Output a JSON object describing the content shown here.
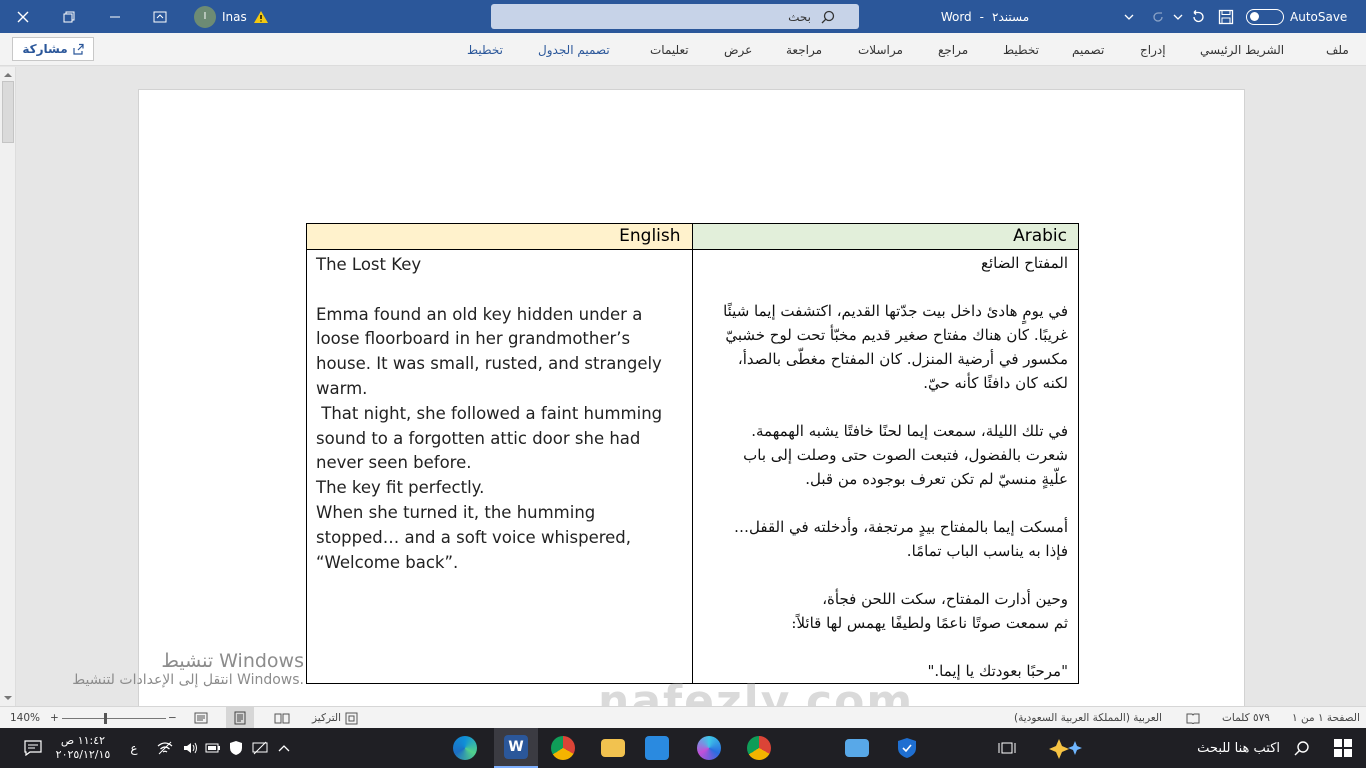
{
  "titlebar": {
    "doc_name": "مستند٢",
    "app_name": "Word",
    "search_placeholder": "بحث",
    "autosave_label": "AutoSave",
    "user_name": "Inas",
    "user_initial": "I"
  },
  "ribbon": {
    "tabs": [
      "ملف",
      "الشريط الرئيسي",
      "إدراج",
      "تصميم",
      "تخطيط",
      "مراجع",
      "مراسلات",
      "مراجعة",
      "عرض",
      "تعليمات"
    ],
    "context_tabs": [
      "تصميم الجدول",
      "تخطيط"
    ],
    "share_label": "مشاركة"
  },
  "table": {
    "header_english": "English",
    "header_arabic": "Arabic",
    "english": {
      "title": "The Lost Key",
      "p1": "Emma found an old key hidden under a loose floorboard in her grandmother’s house. It was small, rusted, and strangely warm.",
      "p2": " That night, she followed a faint humming sound to a forgotten attic door she had never seen before.",
      "p3": "The key fit perfectly.",
      "p4": "When she turned it, the humming stopped… and a soft voice whispered, “Welcome back”."
    },
    "arabic": {
      "title": "المفتاح الضائع",
      "p1": "في يومٍ هادئ داخل بيت جدّتها القديم، اكتشفت إيما شيئًا غريبًا. كان هناك مفتاح صغير قديم مخبّأ تحت لوح خشبيّ مكسور في أرضية المنزل. كان المفتاح مغطّى بالصدأ، لكنه كان دافئًا كأنه حيّ.",
      "p2a": "في تلك الليلة، سمعت إيما لحنًا خافتًا يشبه الهمهمة.",
      "p2b": "شعرت بالفضول، فتبعت الصوت حتى وصلت إلى باب علّيةٍ منسيّ لم تكن تعرف بوجوده من قبل.",
      "p3a": "أمسكت إيما بالمفتاح بيدٍ مرتجفة، وأدخلته في القفل…",
      "p3b": "فإذا به يناسب الباب تمامًا.",
      "p4a": "وحين أدارت المفتاح، سكت اللحن فجأة،",
      "p4b": "ثم سمعت صوتًا ناعمًا ولطيفًا يهمس لها قائلاً:",
      "p5": "\"مرحبًا بعودتك يا إيما.\""
    }
  },
  "watermark": {
    "line1": "تنشيط Windows",
    "line2": "انتقل إلى الإعدادات لتنشيط Windows."
  },
  "brand_watermark": "nafezly.com",
  "statusbar": {
    "page": "الصفحة ١ من ١",
    "words": "٥٧٩ كلمات",
    "language": "العربية (المملكة العربية السعودية)",
    "focus": "التركيز",
    "zoom": "140%"
  },
  "taskbar": {
    "search_placeholder": "اكتب هنا للبحث",
    "time": "١١:٤٢ ص",
    "date": "٢٠٢٥/١٢/١٥",
    "lang": "ع"
  },
  "colors": {
    "word_blue": "#2b579a",
    "header_english_bg": "#fff2cc",
    "header_arabic_bg": "#e2efda"
  }
}
